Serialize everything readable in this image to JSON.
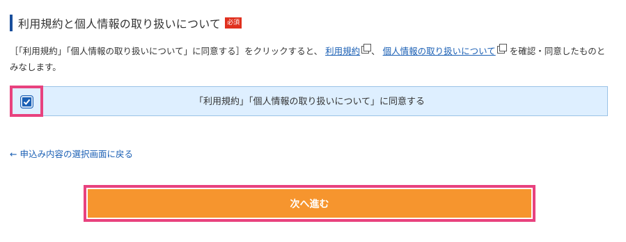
{
  "section": {
    "title": "利用規約と個人情報の取り扱いについて",
    "required_badge": "必須"
  },
  "description": {
    "prefix": "［「利用規約」「個人情報の取り扱いについて」に同意する］をクリックすると、",
    "link_terms": "利用規約",
    "separator": "、",
    "link_privacy": "個人情報の取り扱いについて",
    "suffix": "を確認・同意したものとみなします。"
  },
  "agree": {
    "label": "「利用規約」「個人情報の取り扱いについて」に同意する",
    "checked": true
  },
  "back_link": "← 申込み内容の選択画面に戻る",
  "next_button": "次へ進む",
  "colors": {
    "accent_blue": "#1a5fb4",
    "button_orange": "#f6952e",
    "highlight_pink": "#e8427e",
    "required_red": "#e0301e"
  }
}
